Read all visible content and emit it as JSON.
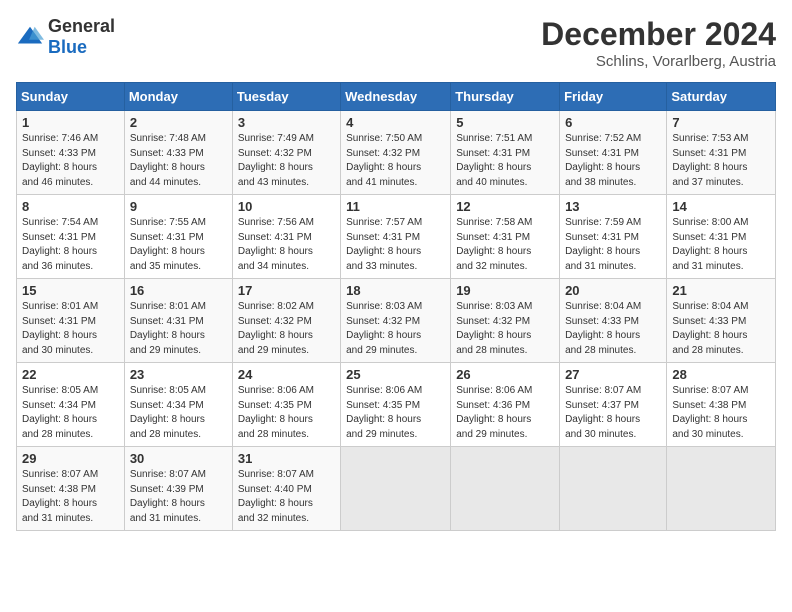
{
  "header": {
    "logo_general": "General",
    "logo_blue": "Blue",
    "month_title": "December 2024",
    "subtitle": "Schlins, Vorarlberg, Austria"
  },
  "weekdays": [
    "Sunday",
    "Monday",
    "Tuesday",
    "Wednesday",
    "Thursday",
    "Friday",
    "Saturday"
  ],
  "weeks": [
    [
      {
        "day": "1",
        "sunrise": "7:46 AM",
        "sunset": "4:33 PM",
        "daylight": "8 hours and 46 minutes."
      },
      {
        "day": "2",
        "sunrise": "7:48 AM",
        "sunset": "4:33 PM",
        "daylight": "8 hours and 44 minutes."
      },
      {
        "day": "3",
        "sunrise": "7:49 AM",
        "sunset": "4:32 PM",
        "daylight": "8 hours and 43 minutes."
      },
      {
        "day": "4",
        "sunrise": "7:50 AM",
        "sunset": "4:32 PM",
        "daylight": "8 hours and 41 minutes."
      },
      {
        "day": "5",
        "sunrise": "7:51 AM",
        "sunset": "4:31 PM",
        "daylight": "8 hours and 40 minutes."
      },
      {
        "day": "6",
        "sunrise": "7:52 AM",
        "sunset": "4:31 PM",
        "daylight": "8 hours and 38 minutes."
      },
      {
        "day": "7",
        "sunrise": "7:53 AM",
        "sunset": "4:31 PM",
        "daylight": "8 hours and 37 minutes."
      }
    ],
    [
      {
        "day": "8",
        "sunrise": "7:54 AM",
        "sunset": "4:31 PM",
        "daylight": "8 hours and 36 minutes."
      },
      {
        "day": "9",
        "sunrise": "7:55 AM",
        "sunset": "4:31 PM",
        "daylight": "8 hours and 35 minutes."
      },
      {
        "day": "10",
        "sunrise": "7:56 AM",
        "sunset": "4:31 PM",
        "daylight": "8 hours and 34 minutes."
      },
      {
        "day": "11",
        "sunrise": "7:57 AM",
        "sunset": "4:31 PM",
        "daylight": "8 hours and 33 minutes."
      },
      {
        "day": "12",
        "sunrise": "7:58 AM",
        "sunset": "4:31 PM",
        "daylight": "8 hours and 32 minutes."
      },
      {
        "day": "13",
        "sunrise": "7:59 AM",
        "sunset": "4:31 PM",
        "daylight": "8 hours and 31 minutes."
      },
      {
        "day": "14",
        "sunrise": "8:00 AM",
        "sunset": "4:31 PM",
        "daylight": "8 hours and 31 minutes."
      }
    ],
    [
      {
        "day": "15",
        "sunrise": "8:01 AM",
        "sunset": "4:31 PM",
        "daylight": "8 hours and 30 minutes."
      },
      {
        "day": "16",
        "sunrise": "8:01 AM",
        "sunset": "4:31 PM",
        "daylight": "8 hours and 29 minutes."
      },
      {
        "day": "17",
        "sunrise": "8:02 AM",
        "sunset": "4:32 PM",
        "daylight": "8 hours and 29 minutes."
      },
      {
        "day": "18",
        "sunrise": "8:03 AM",
        "sunset": "4:32 PM",
        "daylight": "8 hours and 29 minutes."
      },
      {
        "day": "19",
        "sunrise": "8:03 AM",
        "sunset": "4:32 PM",
        "daylight": "8 hours and 28 minutes."
      },
      {
        "day": "20",
        "sunrise": "8:04 AM",
        "sunset": "4:33 PM",
        "daylight": "8 hours and 28 minutes."
      },
      {
        "day": "21",
        "sunrise": "8:04 AM",
        "sunset": "4:33 PM",
        "daylight": "8 hours and 28 minutes."
      }
    ],
    [
      {
        "day": "22",
        "sunrise": "8:05 AM",
        "sunset": "4:34 PM",
        "daylight": "8 hours and 28 minutes."
      },
      {
        "day": "23",
        "sunrise": "8:05 AM",
        "sunset": "4:34 PM",
        "daylight": "8 hours and 28 minutes."
      },
      {
        "day": "24",
        "sunrise": "8:06 AM",
        "sunset": "4:35 PM",
        "daylight": "8 hours and 28 minutes."
      },
      {
        "day": "25",
        "sunrise": "8:06 AM",
        "sunset": "4:35 PM",
        "daylight": "8 hours and 29 minutes."
      },
      {
        "day": "26",
        "sunrise": "8:06 AM",
        "sunset": "4:36 PM",
        "daylight": "8 hours and 29 minutes."
      },
      {
        "day": "27",
        "sunrise": "8:07 AM",
        "sunset": "4:37 PM",
        "daylight": "8 hours and 30 minutes."
      },
      {
        "day": "28",
        "sunrise": "8:07 AM",
        "sunset": "4:38 PM",
        "daylight": "8 hours and 30 minutes."
      }
    ],
    [
      {
        "day": "29",
        "sunrise": "8:07 AM",
        "sunset": "4:38 PM",
        "daylight": "8 hours and 31 minutes."
      },
      {
        "day": "30",
        "sunrise": "8:07 AM",
        "sunset": "4:39 PM",
        "daylight": "8 hours and 31 minutes."
      },
      {
        "day": "31",
        "sunrise": "8:07 AM",
        "sunset": "4:40 PM",
        "daylight": "8 hours and 32 minutes."
      },
      null,
      null,
      null,
      null
    ]
  ]
}
